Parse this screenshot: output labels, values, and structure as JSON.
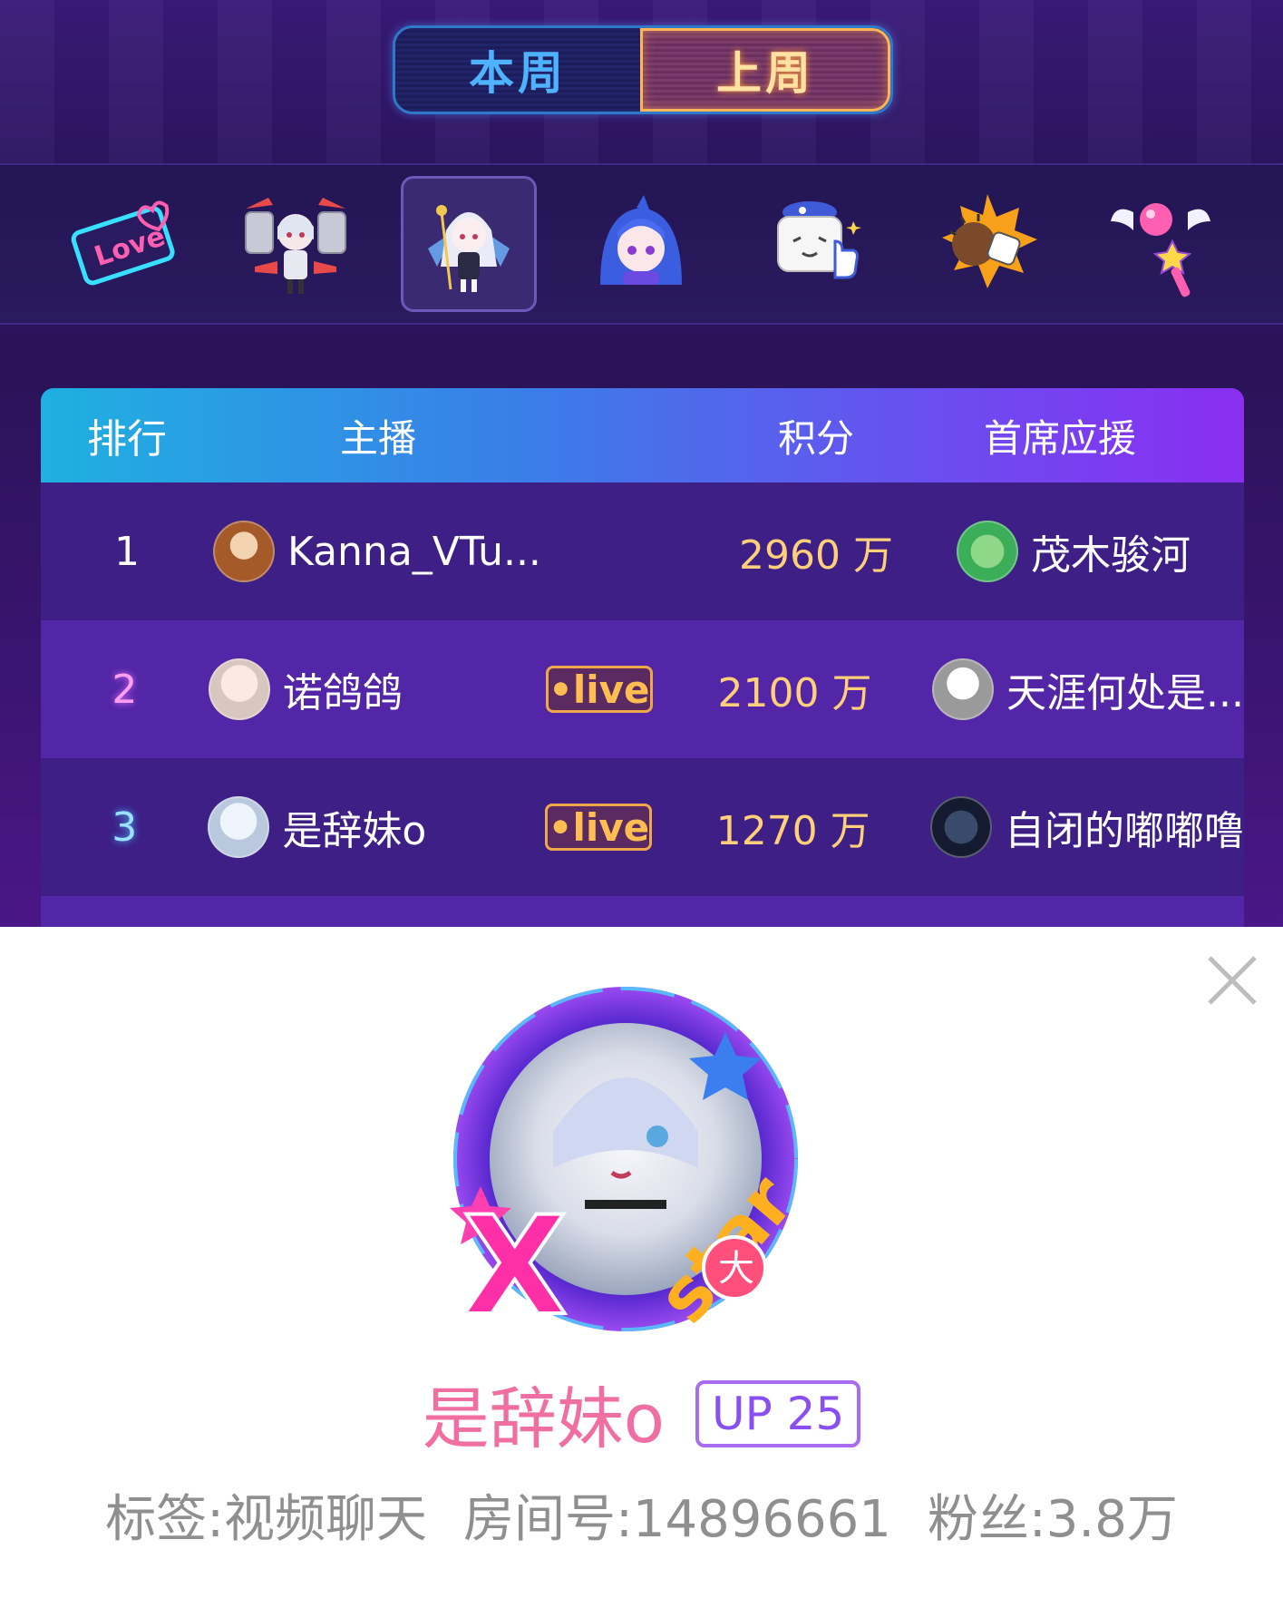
{
  "tabs": [
    {
      "label": "本周",
      "active": false
    },
    {
      "label": "上周",
      "active": true
    }
  ],
  "gifts": [
    {
      "icon": "love-sign-icon",
      "selected": false
    },
    {
      "icon": "mecha-girl-icon",
      "selected": false
    },
    {
      "icon": "white-hair-girl-icon",
      "selected": true
    },
    {
      "icon": "blue-hair-girl-icon",
      "selected": false
    },
    {
      "icon": "tv-thumbs-up-icon",
      "selected": false
    },
    {
      "icon": "spiked-fist-icon",
      "selected": false
    },
    {
      "icon": "magic-wand-icon",
      "selected": false
    }
  ],
  "table": {
    "headers": {
      "rank": "排行",
      "anchor": "主播",
      "score": "积分",
      "top_fan": "首席应援"
    },
    "rows": [
      {
        "rank": "1",
        "anchor": "Kanna_VTu...",
        "live": "",
        "score": "2960 万",
        "top_fan": "茂木骏河"
      },
      {
        "rank": "2",
        "anchor": "诺鸽鸽",
        "live": "•live",
        "score": "2100 万",
        "top_fan": "天涯何处是..."
      },
      {
        "rank": "3",
        "anchor": "是辞妹o",
        "live": "•live",
        "score": "1270 万",
        "top_fan": "自闭的嘟嘟噜"
      }
    ]
  },
  "profile": {
    "name": "是辞妹o",
    "level": "UP 25",
    "tag": "标签:视频聊天",
    "room": "房间号:14896661",
    "fans": "粉丝:3.8万"
  },
  "colors": {
    "score": "#ffcf7a",
    "live": "#ffbd52",
    "profile_name": "#f06fa3",
    "level": "#8a4ff0"
  }
}
